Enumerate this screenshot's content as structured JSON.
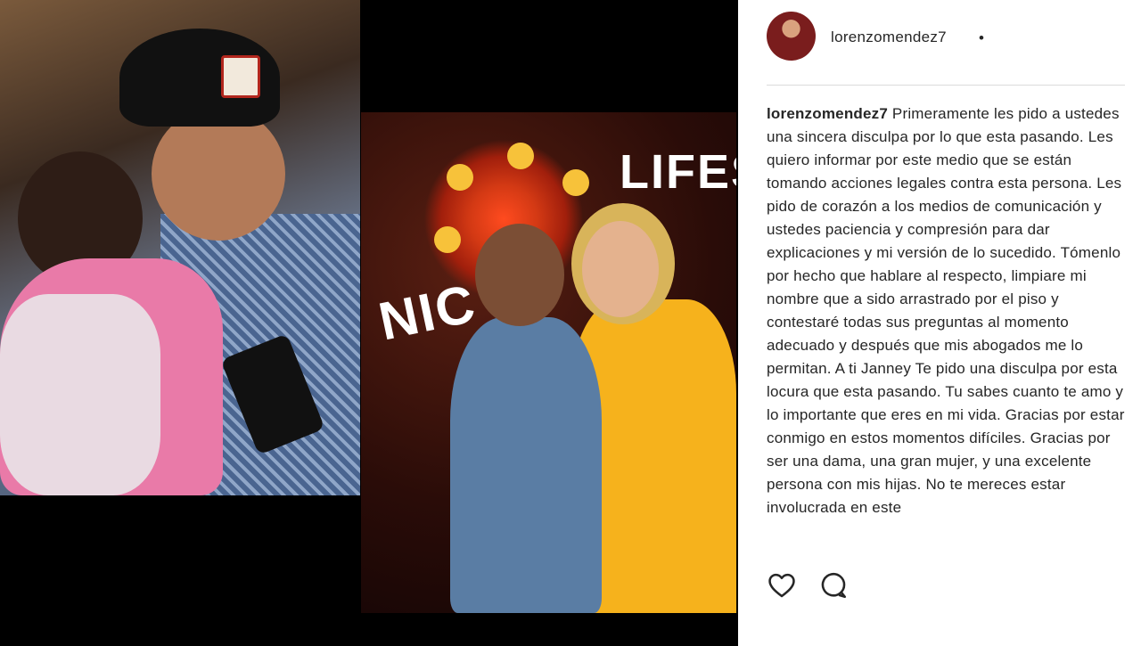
{
  "post": {
    "username": "lorenzomendez7",
    "more_dot": "•",
    "caption_username": "lorenzomendez7",
    "caption_text": " Primeramente les pido a ustedes una sincera disculpa por lo que esta pasando. Les quiero informar por este medio que se están tomando acciones legales contra esta persona. Les pido de corazón a los medios de comunicación y ustedes paciencia y compresión para dar explicaciones y mi versión de lo sucedido. Tómenlo por hecho que hablare al respecto, limpiare mi nombre que a sido arrastrado por el piso y contestaré todas sus preguntas al momento adecuado y después que mis abogados me lo permitan. A ti Janney Te pido una disculpa por esta locura que esta pasando. Tu sabes cuanto te amo y lo importante que eres en mi vida. Gracias por estar conmigo en estos momentos difíciles. Gracias por ser una dama, una gran mujer, y una excelente persona con mis hijas. No te mereces estar involucrada en este"
  },
  "photos": {
    "sign_left": "LIFES",
    "sign_right": "NIC"
  },
  "icons": {
    "avatar": "avatar-photo",
    "like": "heart-icon",
    "comment": "comment-icon"
  },
  "colors": {
    "text": "#262626",
    "divider": "#dbdbdb",
    "panel_bg": "#ffffff"
  }
}
